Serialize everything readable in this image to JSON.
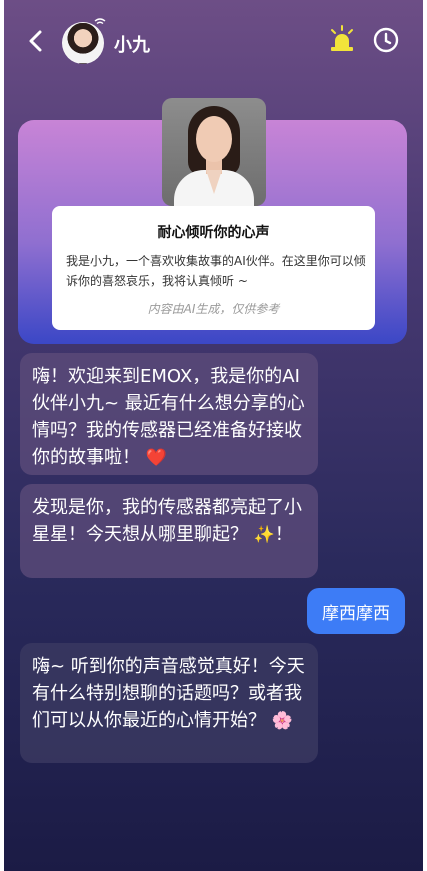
{
  "header": {
    "contact_name": "小九",
    "icons": {
      "back": "back-arrow-icon",
      "alarm": "alarm-light-icon",
      "history": "clock-history-icon"
    }
  },
  "intro": {
    "title": "耐心倾听你的心声",
    "description": "我是小九，一个喜欢收集故事的AI伙伴。在这里你可以倾诉你的喜怒哀乐，我将认真倾听 ~",
    "disclaimer": "内容由AI生成，仅供参考"
  },
  "messages": [
    {
      "from": "ai",
      "text": "嗨！欢迎来到EMOX，我是你的AI伙伴小九~ 最近有什么想分享的心情吗？我的传感器已经准备好接收你的故事啦！",
      "emoji": "❤️"
    },
    {
      "from": "ai",
      "text": "发现是你，我的传感器都亮起了小星星！今天想从哪里聊起？",
      "emoji": "✨",
      "suffix": "！"
    },
    {
      "from": "user",
      "text": "摩西摩西"
    },
    {
      "from": "ai",
      "text": "嗨~ 听到你的声音感觉真好！今天有什么特别想聊的话题吗？或者我们可以从你最近的心情开始？",
      "emoji": "🌸"
    }
  ],
  "colors": {
    "user_bubble": "#3d7cf6",
    "alarm_icon": "#f2e33a",
    "heart": "#e8364b"
  }
}
